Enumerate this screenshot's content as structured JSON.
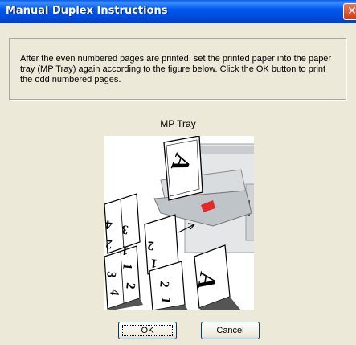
{
  "window": {
    "title": "Manual Duplex Instructions",
    "close_glyph": "✕"
  },
  "instructions": "After the even numbered pages are printed, set the printed paper into the paper tray (MP Tray) again according to the figure below. Click the OK button to print the odd numbered pages.",
  "figure": {
    "caption": "MP Tray",
    "page_labels": [
      "4",
      "3",
      "2",
      "1",
      "2",
      "1",
      "3",
      "1",
      "4",
      "2",
      "A",
      "2",
      "1",
      "A"
    ],
    "accent_color": "#e8272a"
  },
  "buttons": {
    "ok": "OK",
    "cancel": "Cancel"
  },
  "colors": {
    "titlebar": "#0058ee",
    "dialog_bg": "#ece9d8"
  }
}
